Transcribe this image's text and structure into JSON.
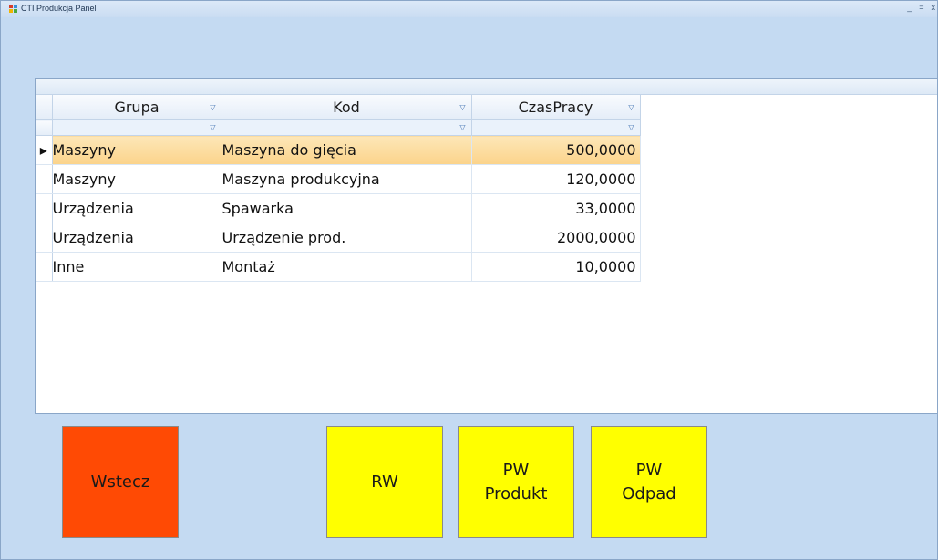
{
  "window": {
    "title": "CTI Produkcja Panel",
    "controls": [
      "_",
      "=",
      "x"
    ]
  },
  "grid": {
    "columns": [
      {
        "label": "Grupa"
      },
      {
        "label": "Kod"
      },
      {
        "label": "CzasPracy"
      }
    ],
    "rows": [
      {
        "grupa": "Maszyny",
        "kod": "Maszyna do gięcia",
        "czas": "500,0000",
        "selected": true
      },
      {
        "grupa": "Maszyny",
        "kod": "Maszyna produkcyjna",
        "czas": "120,0000"
      },
      {
        "grupa": "Urządzenia",
        "kod": "Spawarka",
        "czas": "33,0000"
      },
      {
        "grupa": "Urządzenia",
        "kod": "Urządzenie prod.",
        "czas": "2000,0000"
      },
      {
        "grupa": "Inne",
        "kod": "Montaż",
        "czas": "10,0000"
      }
    ],
    "row_indicator": "▸"
  },
  "buttons": {
    "back": {
      "label": "Wstecz",
      "color": "#ff4a04"
    },
    "rw": {
      "label": "RW",
      "color": "#ffff00"
    },
    "pw_produkt": {
      "label": "PW\nProdukt",
      "color": "#ffff00"
    },
    "pw_odpad": {
      "label": "PW\nOdpad",
      "color": "#ffff00"
    }
  },
  "colors": {
    "window_bg": "#c4daf2",
    "selected_row": "#fbd38a",
    "filter_icon": "#3d6fb0"
  }
}
